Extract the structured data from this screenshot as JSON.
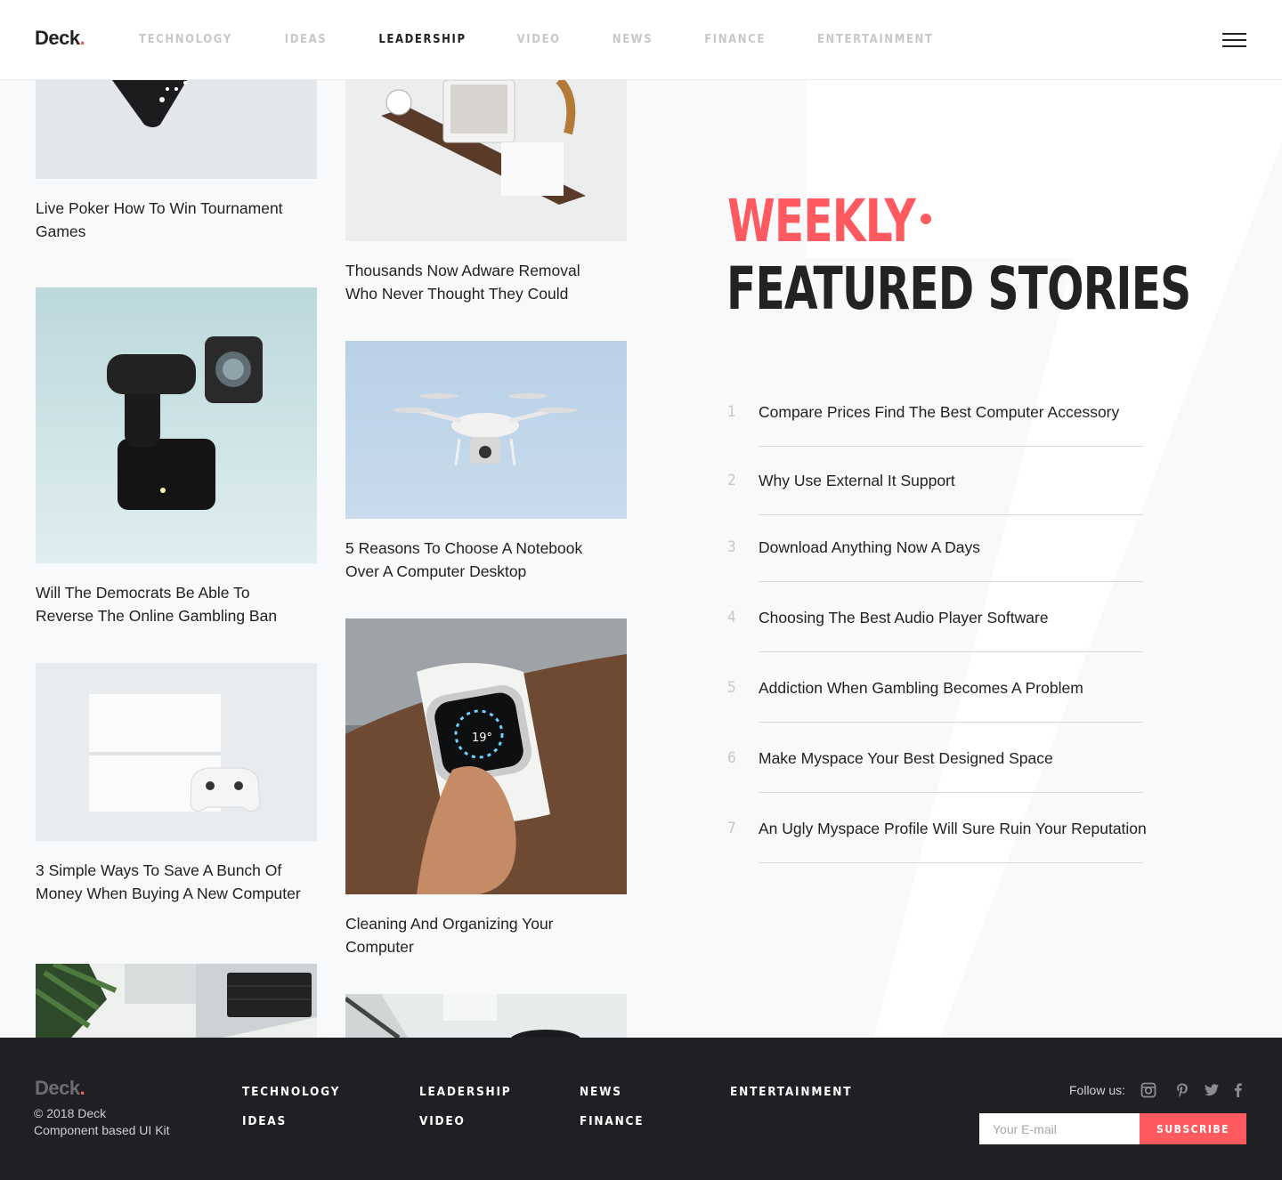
{
  "header": {
    "logo": "Deck",
    "logo_dot": ".",
    "nav": [
      "TECHNOLOGY",
      "IDEAS",
      "LEADERSHIP",
      "VIDEO",
      "NEWS",
      "FINANCE",
      "ENTERTAINMENT"
    ],
    "active_nav": "LEADERSHIP"
  },
  "articles": {
    "left": [
      "Live Poker How To Win Tournament Games",
      "Will The Democrats Be Able To Reverse The Online Gambling Ban",
      "3 Simple Ways To Save A Bunch Of Money When Buying A New Computer"
    ],
    "right": [
      "Thousands Now Adware Removal Who Never Thought They Could",
      "5 Reasons To Choose A Notebook Over A Computer Desktop",
      "Cleaning And Organizing Your Computer"
    ]
  },
  "featured": {
    "heading_accent": "WEEKLY",
    "heading_main": "FEATURED STORIES",
    "items": [
      {
        "num": "1",
        "title": "Compare Prices Find The Best Computer Accessory"
      },
      {
        "num": "2",
        "title": "Why Use External It Support"
      },
      {
        "num": "3",
        "title": "Download Anything Now A Days"
      },
      {
        "num": "4",
        "title": "Choosing The Best Audio Player Software"
      },
      {
        "num": "5",
        "title": "Addiction When Gambling Becomes A Problem"
      },
      {
        "num": "6",
        "title": "Make Myspace Your Best Designed Space"
      },
      {
        "num": "7",
        "title": "An Ugly Myspace Profile Will Sure Ruin Your Reputation"
      }
    ]
  },
  "footer": {
    "logo": "Deck",
    "logo_dot": ".",
    "copyright": "© 2018 Deck",
    "tagline": "Component based UI Kit",
    "links": [
      "TECHNOLOGY",
      "IDEAS",
      "LEADERSHIP",
      "VIDEO",
      "NEWS",
      "FINANCE",
      "ENTERTAINMENT"
    ],
    "follow_label": "Follow us:",
    "social_icons": [
      "instagram-icon",
      "pinterest-icon",
      "twitter-icon",
      "facebook-icon"
    ],
    "email_placeholder": "Your E-mail",
    "subscribe_label": "SUBSCRIBE"
  },
  "colors": {
    "accent": "#ff5a5f",
    "dark": "#222222",
    "footer_bg": "#1f2024",
    "panel_bg": "#f8f9fb"
  }
}
